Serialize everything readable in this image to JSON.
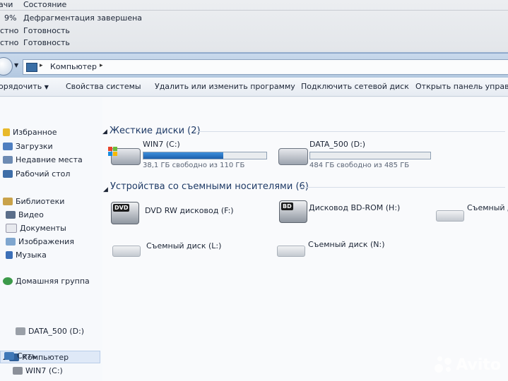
{
  "defrag": {
    "headers": [
      "ачи",
      "Состояние"
    ],
    "rows": [
      {
        "progress": "9%",
        "status": "Дефрагментация завершена"
      },
      {
        "progress": "стно",
        "status": "Готовность"
      },
      {
        "progress": "стно",
        "status": "Готовность"
      }
    ]
  },
  "address": {
    "location": "Компьютер",
    "arrow": "▸"
  },
  "toolbar": {
    "organize": "орядочить",
    "system_props": "Свойства системы",
    "uninstall": "Удалить или изменить программу",
    "map_drive": "Подключить сетевой диск",
    "control_panel": "Открыть панель управлени"
  },
  "sidebar": {
    "favorites": "Избранное",
    "downloads": "Загрузки",
    "recent": "Недавние места",
    "desktop": "Рабочий стол",
    "libraries": "Библиотеки",
    "video": "Видео",
    "documents": "Документы",
    "images": "Изображения",
    "music": "Музыка",
    "homegroup": "Домашняя группа",
    "computer": "Компьютер",
    "drive_c": "WIN7 (C:)",
    "drive_d": "DATA_500 (D:)",
    "network": "Сеть"
  },
  "content": {
    "hdd_group": "Жесткие диски (2)",
    "removable_group": "Устройства со съемными носителями (6)",
    "drives": [
      {
        "name": "WIN7 (C:)",
        "free_text": "38,1 ГБ свободно из 110 ГБ",
        "used_fraction": 0.65
      },
      {
        "name": "DATA_500 (D:)",
        "free_text": "484 ГБ свободно из 485 ГБ",
        "used_fraction": 0.002
      }
    ],
    "devices": [
      {
        "name": "DVD RW дисковод (F:)",
        "badge": "DVD"
      },
      {
        "name": "Дисковод BD-ROM (H:)",
        "badge": "BD"
      },
      {
        "name": "Съемный ди"
      },
      {
        "name": "Съемный диск (L:)"
      },
      {
        "name": "Съемный диск (N:)"
      }
    ]
  },
  "watermark": "Avito"
}
